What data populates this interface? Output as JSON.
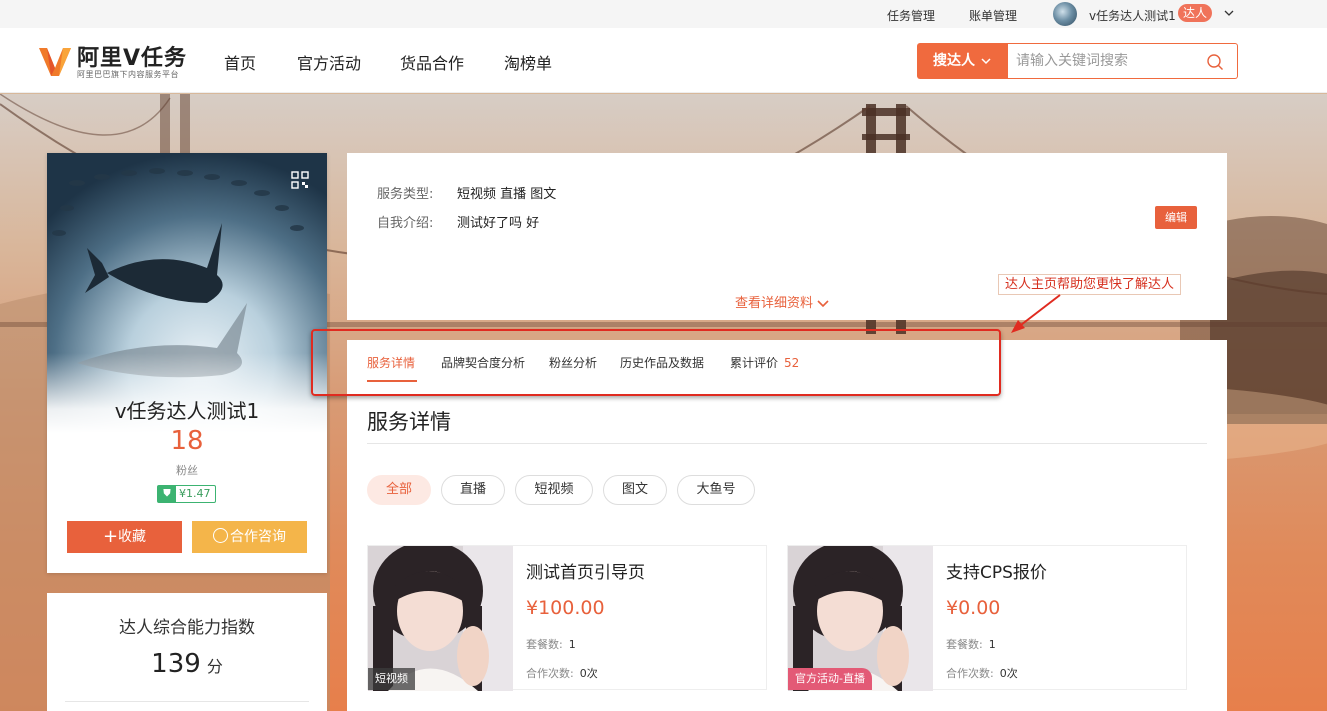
{
  "topbar": {
    "task_manage": "任务管理",
    "bill_manage": "账单管理",
    "username": "v任务达人测试1",
    "role_badge": "达人"
  },
  "header": {
    "logo_text": "阿里V任务",
    "logo_sub": "阿里巴巴旗下内容服务平台",
    "nav": [
      "首页",
      "官方活动",
      "货品合作",
      "淘榜单"
    ],
    "search_type": "搜达人",
    "search_placeholder": "请输入关键词搜索"
  },
  "profile": {
    "name": "v任务达人测试1",
    "fans_count": "18",
    "fans_label": "粉丝",
    "price": "¥1.47",
    "favorite_label": "收藏",
    "consult_label": "合作咨询"
  },
  "ability": {
    "title": "达人综合能力指数",
    "score": "139",
    "unit": "分"
  },
  "info": {
    "service_type_label": "服务类型:",
    "service_type_value": "短视频 直播 图文",
    "intro_label": "自我介绍:",
    "intro_value": "测试好了吗 好",
    "edit_label": "编辑",
    "more_label": "查看详细资料"
  },
  "annotation": {
    "text": "达人主页帮助您更快了解达人"
  },
  "tabs": {
    "items": [
      "服务详情",
      "品牌契合度分析",
      "粉丝分析",
      "历史作品及数据",
      "累计评价"
    ],
    "review_count": "52"
  },
  "section": {
    "title": "服务详情",
    "chips": [
      "全部",
      "直播",
      "短视频",
      "图文",
      "大鱼号"
    ]
  },
  "services": [
    {
      "title": "测试首页引导页",
      "price": "¥100.00",
      "package_label": "套餐数:",
      "package_value": "1",
      "coop_label": "合作次数:",
      "coop_value": "0次",
      "tag": "短视频"
    },
    {
      "title": "支持CPS报价",
      "price": "¥0.00",
      "package_label": "套餐数:",
      "package_value": "1",
      "coop_label": "合作次数:",
      "coop_value": "0次",
      "tag": "官方活动-直播"
    }
  ],
  "colors": {
    "brand": "#e8613c",
    "accent_yellow": "#f4b54a",
    "annotation_red": "#e02b20",
    "tag_pink": "#e35a76"
  }
}
